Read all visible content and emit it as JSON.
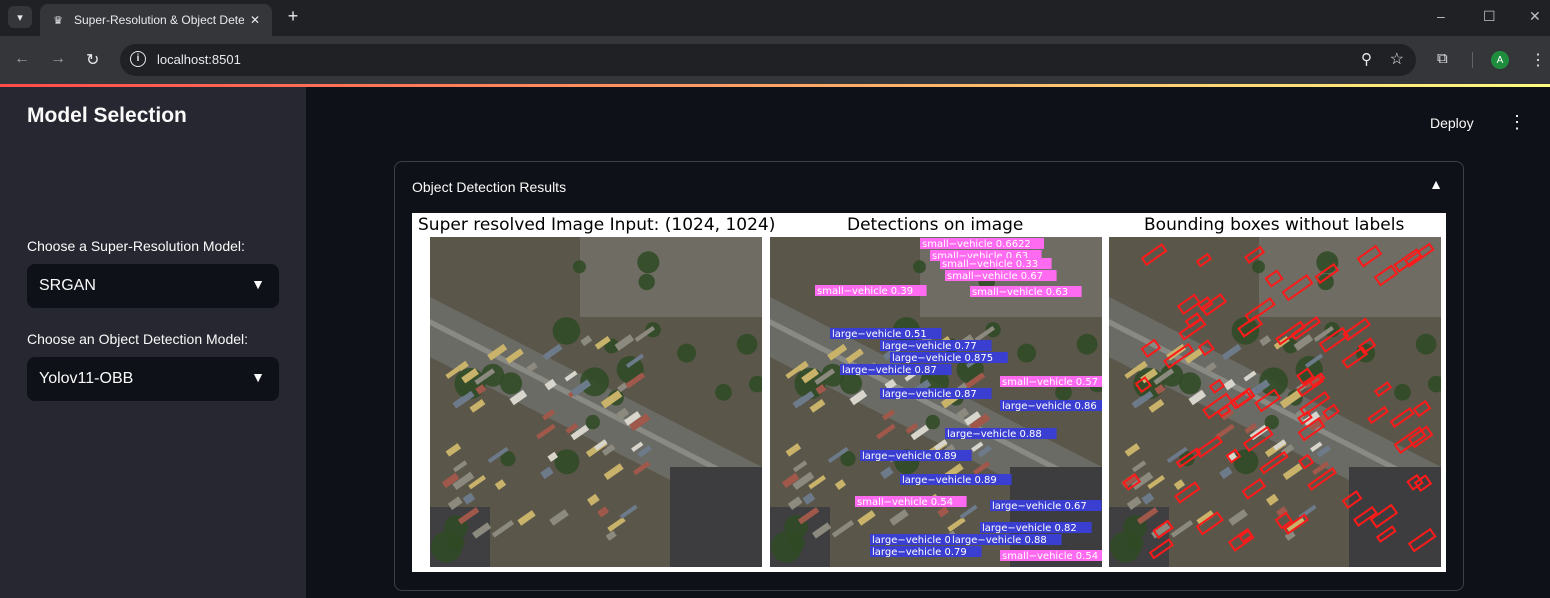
{
  "browser": {
    "tab_title": "Super-Resolution & Object Detection",
    "tab_close": "✕",
    "new_tab": "+",
    "url": "localhost:8501",
    "avatar_letter": "A",
    "window_controls": [
      "–",
      "☐",
      "✕"
    ]
  },
  "header": {
    "deploy_label": "Deploy",
    "menu_icon": "⋮"
  },
  "sidebar": {
    "title": "Model Selection",
    "sr_label": "Choose a Super-Resolution Model:",
    "sr_value": "SRGAN",
    "od_label": "Choose an Object Detection Model:",
    "od_value": "Yolov11-OBB"
  },
  "main": {
    "expander_title": "Object Detection Results",
    "figure": {
      "panels": [
        {
          "title": "Super resolved Image Input: (1024, 1024)"
        },
        {
          "title": "Detections on image"
        },
        {
          "title": "Bounding boxes without labels"
        }
      ],
      "detection_labels_small": [
        "small−vehicle 0.6622",
        "small−vehicle 0.63",
        "small−vehicle 0.33",
        "small−vehicle 0.67",
        "small−vehicle 0.63",
        "small−vehicle 0.39",
        "small−vehicle 0.57",
        "small−vehicle 0.54",
        "small−vehicle 0.54"
      ],
      "detection_labels_large": [
        "large−vehicle 0.51",
        "large−vehicle 0.77",
        "large−vehicle 0.875",
        "large−vehicle 0.87",
        "large−vehicle 0.87",
        "large−vehicle 0.86",
        "large−vehicle 0.88",
        "large−vehicle 0.89",
        "large−vehicle 0.89",
        "large−vehicle 0.67",
        "large−vehicle 0.82",
        "large−vehicle 0.89",
        "large−vehicle 0.88",
        "large−vehicle 0.79"
      ],
      "colors": {
        "small_vehicle": "#ff6bf0",
        "large_vehicle": "#3b3fd1",
        "box_no_label": "#ff1a1a"
      }
    }
  }
}
